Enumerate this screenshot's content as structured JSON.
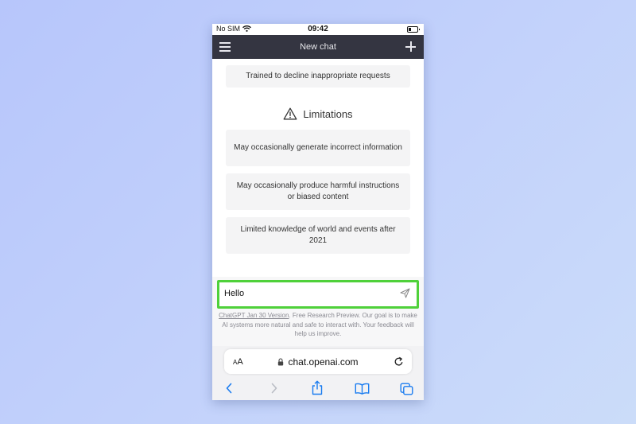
{
  "status": {
    "carrier": "No SIM",
    "time": "09:42"
  },
  "header": {
    "title": "New chat"
  },
  "capabilities": {
    "last_item": "Trained to decline inappropriate requests"
  },
  "limitations": {
    "title": "Limitations",
    "items": [
      "May occasionally generate incorrect information",
      "May occasionally produce harmful instructions or biased content",
      "Limited knowledge of world and events after 2021"
    ]
  },
  "composer": {
    "value": "Hello"
  },
  "footer": {
    "link": "ChatGPT Jan 30 Version",
    "text": ". Free Research Preview. Our goal is to make AI systems more natural and safe to interact with. Your feedback will help us improve."
  },
  "browser": {
    "aa_small": "A",
    "aa_large": "A",
    "url": "chat.openai.com"
  },
  "colors": {
    "header_bg": "#343541",
    "highlight": "#4fd13a",
    "safari_blue": "#1a7cf0"
  }
}
